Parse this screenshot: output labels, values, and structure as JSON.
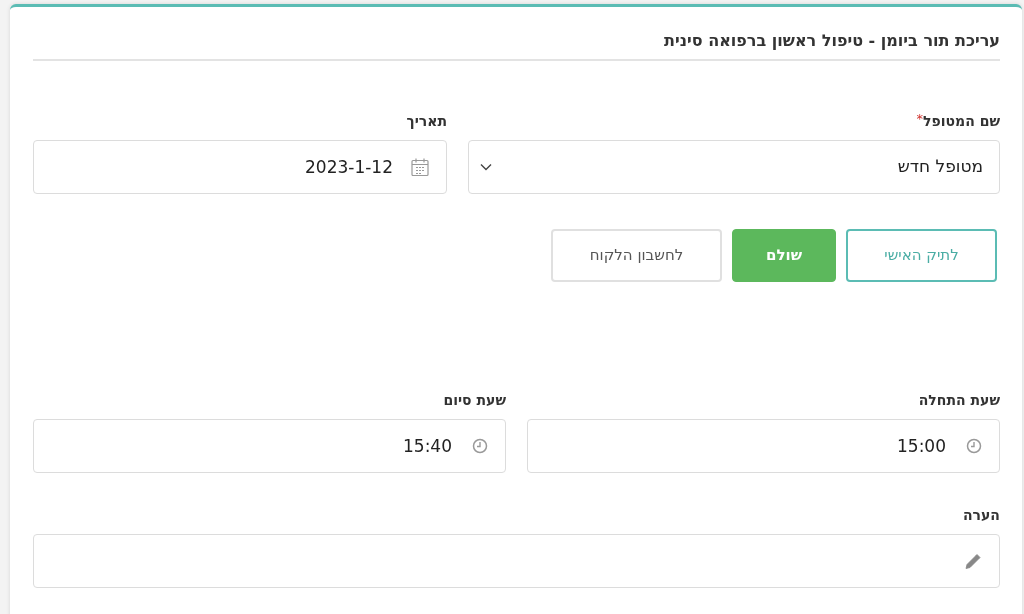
{
  "title": "עריכת תור ביומן - טיפול ראשון ברפואה סינית",
  "patient": {
    "label": "שם המטופל",
    "required_mark": "*",
    "value": "מטופל חדש"
  },
  "date": {
    "label": "תאריך",
    "value": "2023-1-12"
  },
  "buttons": [
    {
      "label": "לתיק האישי",
      "kind": "outline"
    },
    {
      "label": "שולם",
      "kind": "success"
    },
    {
      "label": "לחשבון הלקוח",
      "kind": "plain"
    }
  ],
  "start_time": {
    "label": "שעת התחלה",
    "value": "15:00"
  },
  "end_time": {
    "label": "שעת סיום",
    "value": "15:40"
  },
  "note": {
    "label": "הערה"
  }
}
